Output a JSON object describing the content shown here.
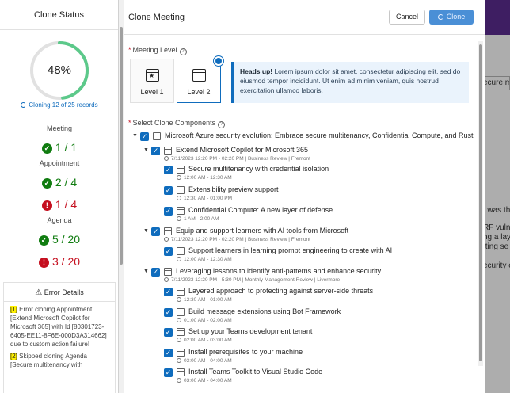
{
  "background": {
    "search_fragment": "ecure me",
    "frags": [
      "| was th",
      "RF vulne",
      "ng a lay",
      "tting se",
      "ecurity o"
    ]
  },
  "left_panel": {
    "title": "Clone Status",
    "progress_percent": 48,
    "progress_label": "48%",
    "cloning_text": "Cloning 12 of 25 records",
    "sections": [
      {
        "name": "Meeting",
        "stats": [
          {
            "status": "success",
            "text": "1 / 1"
          }
        ]
      },
      {
        "name": "Appointment",
        "stats": [
          {
            "status": "success",
            "text": "2 / 4"
          },
          {
            "status": "error",
            "text": "1 / 4"
          }
        ]
      },
      {
        "name": "Agenda",
        "stats": [
          {
            "status": "success",
            "text": "5 / 20"
          },
          {
            "status": "error",
            "text": "3 / 20"
          }
        ]
      }
    ],
    "error_details": {
      "title": "Error Details",
      "items": [
        {
          "num": "[1]",
          "text": " Error cloning Appointment [Extend Microsoft Copilot for Microsoft 365] with Id [80301723-6405-EE11-8F6E-000D3A314662] due to custom action failure!"
        },
        {
          "num": "[2]",
          "text": " Skipped cloning Agenda [Secure multitenancy with"
        }
      ]
    }
  },
  "dialog": {
    "title": "Clone Meeting",
    "cancel_label": "Cancel",
    "clone_label": "Clone",
    "meeting_level_label": "Meeting Level",
    "levels": [
      {
        "label": "Level 1",
        "selected": false
      },
      {
        "label": "Level 2",
        "selected": true
      }
    ],
    "notice": {
      "bold": "Heads up!",
      "text": " Lorem ipsum dolor sit amet, consectetur adipiscing elit, sed do eiusmod tempor incididunt. Ut enim ad minim veniam, quis nostrud exercitation ullamco laboris."
    },
    "components_label": "Select Clone Components",
    "tree": [
      {
        "level": 0,
        "title": "Microsoft Azure security evolution: Embrace secure multitenancy, Confidential Compute, and Rust",
        "sub": ""
      },
      {
        "level": 1,
        "title": "Extend Microsoft Copilot for Microsoft 365",
        "sub": "7/11/2023 12:20 PM - 02:20 PM | Business Review | Fremont"
      },
      {
        "level": 2,
        "title": "Secure multitenancy with credential isolation",
        "sub": "12:00 AM - 12:30 AM"
      },
      {
        "level": 2,
        "title": "Extensibility preview support",
        "sub": "12:30 AM - 01:00 PM"
      },
      {
        "level": 2,
        "title": "Confidential Compute: A new layer of defense",
        "sub": "1 AM - 2:00 AM"
      },
      {
        "level": 1,
        "title": "Equip and support learners with AI tools from Microsoft",
        "sub": "7/11/2023 12:20 PM - 02:20 PM | Business Review | Fremont"
      },
      {
        "level": 2,
        "title": "Support learners in learning prompt engineering to create with AI",
        "sub": "12:00 AM - 12:30 AM"
      },
      {
        "level": 1,
        "title": "Leveraging lessons to identify anti-patterns and enhance security",
        "sub": "7/11/2023 12:20 PM - 5:30 PM | Monthly Management Review | Livermore"
      },
      {
        "level": 2,
        "title": "Layered approach to protecting against server-side threats",
        "sub": "12:30 AM - 01:00 AM"
      },
      {
        "level": 2,
        "title": "Build message extensions using Bot Framework",
        "sub": "01:00 AM - 02:00 AM"
      },
      {
        "level": 2,
        "title": "Set up your Teams development tenant",
        "sub": "02:00 AM - 03:00 AM"
      },
      {
        "level": 2,
        "title": "Install prerequisites to your machine",
        "sub": "03:00 AM - 04:00 AM"
      },
      {
        "level": 2,
        "title": "Install Teams Toolkit to Visual Studio Code",
        "sub": "03:00 AM - 04:00 AM"
      }
    ]
  },
  "colors": {
    "success": "#107c10",
    "error": "#c50f1f",
    "accent": "#0f6cbd"
  }
}
